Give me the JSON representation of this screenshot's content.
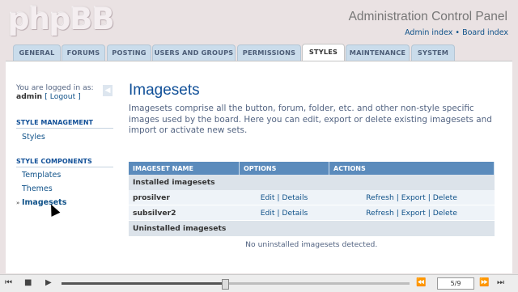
{
  "header": {
    "logo": "phpBB",
    "title": "Administration Control Panel",
    "link_admin_index": "Admin index",
    "separator": "•",
    "link_board_index": "Board index"
  },
  "tabs": [
    {
      "label": "GENERAL"
    },
    {
      "label": "FORUMS"
    },
    {
      "label": "POSTING"
    },
    {
      "label": "USERS AND GROUPS"
    },
    {
      "label": "PERMISSIONS"
    },
    {
      "label": "STYLES",
      "active": true
    },
    {
      "label": "MAINTENANCE"
    },
    {
      "label": "SYSTEM"
    }
  ],
  "sidebar": {
    "logged_in_label": "You are logged in as:",
    "username": "admin",
    "logout": "[ Logout ]",
    "section_management": "STYLE MANAGEMENT",
    "item_styles": "Styles",
    "section_components": "STYLE COMPONENTS",
    "item_templates": "Templates",
    "item_themes": "Themes",
    "item_imagesets": "Imagesets"
  },
  "main": {
    "title": "Imagesets",
    "description": "Imagesets comprise all the button, forum, folder, etc. and other non-style specific images used by the board. Here you can edit, export or delete existing imagesets and import or activate new sets.",
    "table": {
      "headers": [
        "IMAGESET NAME",
        "OPTIONS",
        "ACTIONS"
      ],
      "installed_label": "Installed imagesets",
      "rows": [
        {
          "name": "prosilver",
          "options": "Edit | Details",
          "actions": "Refresh | Export | Delete"
        },
        {
          "name": "subsilver2",
          "options": "Edit | Details",
          "actions": "Refresh | Export | Delete"
        }
      ],
      "uninstalled_label": "Uninstalled imagesets",
      "empty_message": "No uninstalled imagesets detected."
    }
  },
  "player": {
    "page_indicator": "5/9",
    "progress": 0.47
  }
}
